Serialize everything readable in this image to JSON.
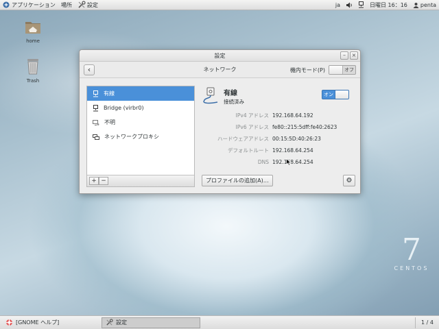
{
  "top_panel": {
    "applications": "アプリケーション",
    "places": "場所",
    "settings": "設定",
    "lang": "ja",
    "clock": "日曜日 16：16",
    "user": "penta"
  },
  "desktop": {
    "home_label": "home",
    "trash_label": "Trash"
  },
  "window": {
    "title": "設定",
    "header_title": "ネットワーク",
    "airplane_label": "機内モード(P)",
    "airplane_state": "オフ",
    "sidebar": [
      {
        "label": "有線",
        "icon": "wired-icon",
        "selected": true
      },
      {
        "label": "Bridge (virbr0)",
        "icon": "wired-icon",
        "selected": false
      },
      {
        "label": "不明",
        "icon": "unknown-device-icon",
        "selected": false
      },
      {
        "label": "ネットワークプロキシ",
        "icon": "proxy-icon",
        "selected": false
      }
    ],
    "add": "+",
    "remove": "−",
    "device": {
      "name": "有線",
      "status": "接続済み",
      "switch_state": "オン"
    },
    "properties": [
      {
        "key": "IPv4 アドレス",
        "value": "192.168.64.192"
      },
      {
        "key": "IPv6 アドレス",
        "value": "fe80::215:5dff:fe40:2623"
      },
      {
        "key": "ハードウェアアドレス",
        "value": "00:15:5D:40:26:23"
      },
      {
        "key": "デフォルトルート",
        "value": "192.168.64.254"
      },
      {
        "key": "DNS",
        "value": "192.168.64.254"
      }
    ],
    "add_profile": "プロファイルの追加(A)…"
  },
  "branding": {
    "number": "7",
    "word": "CENTOS"
  },
  "bottom_panel": {
    "help_task": "[GNOME ヘルプ]",
    "settings_task": "設定",
    "workspace": "1 / 4"
  },
  "colors": {
    "accent": "#4a90d9"
  }
}
